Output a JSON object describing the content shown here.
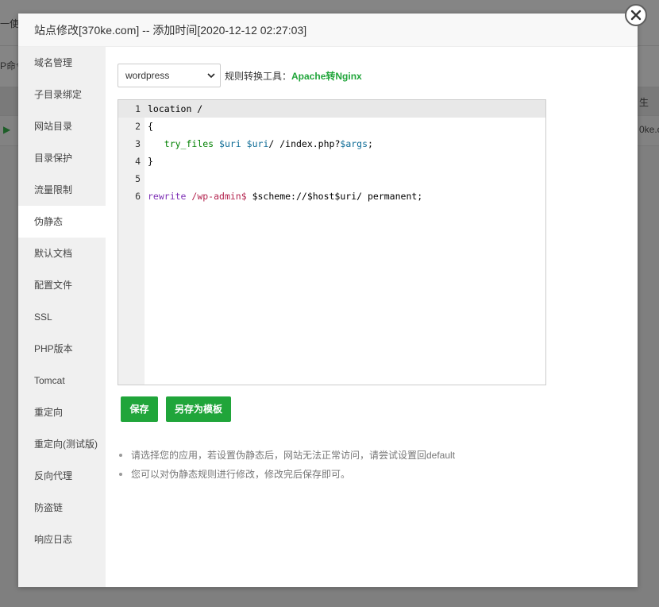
{
  "background": {
    "texts": [
      "一使用",
      "P命令",
      "生",
      "0ke.c"
    ]
  },
  "modal": {
    "title": "站点修改[370ke.com] -- 添加时间[2020-12-12 02:27:03]",
    "close_icon": "close-icon"
  },
  "sidebar": {
    "items": [
      {
        "label": "域名管理"
      },
      {
        "label": "子目录绑定"
      },
      {
        "label": "网站目录"
      },
      {
        "label": "目录保护"
      },
      {
        "label": "流量限制"
      },
      {
        "label": "伪静态"
      },
      {
        "label": "默认文档"
      },
      {
        "label": "配置文件"
      },
      {
        "label": "SSL"
      },
      {
        "label": "PHP版本"
      },
      {
        "label": "Tomcat"
      },
      {
        "label": "重定向"
      },
      {
        "label": "重定向(测试版)"
      },
      {
        "label": "反向代理"
      },
      {
        "label": "防盗链"
      },
      {
        "label": "响应日志"
      }
    ],
    "active_index": 5
  },
  "toolbar": {
    "select_value": "wordpress",
    "tool_label": "规则转换工具：",
    "tool_link": "Apache转Nginx"
  },
  "editor": {
    "lines": [
      {
        "num": "1",
        "text": "location /"
      },
      {
        "num": "2",
        "text": "{"
      },
      {
        "num": "3",
        "text": "   try_files $uri $uri/ /index.php?$args;"
      },
      {
        "num": "4",
        "text": "}"
      },
      {
        "num": "5",
        "text": ""
      },
      {
        "num": "6",
        "text": "rewrite /wp-admin$ $scheme://$host$uri/ permanent;"
      }
    ]
  },
  "buttons": {
    "save": "保存",
    "save_as_template": "另存为模板"
  },
  "tips": [
    "请选择您的应用，若设置伪静态后，网站无法正常访问，请尝试设置回default",
    "您可以对伪静态规则进行修改，修改完后保存即可。"
  ],
  "colors": {
    "accent": "#20a53a",
    "sidebar_bg": "#f0f0f0"
  }
}
